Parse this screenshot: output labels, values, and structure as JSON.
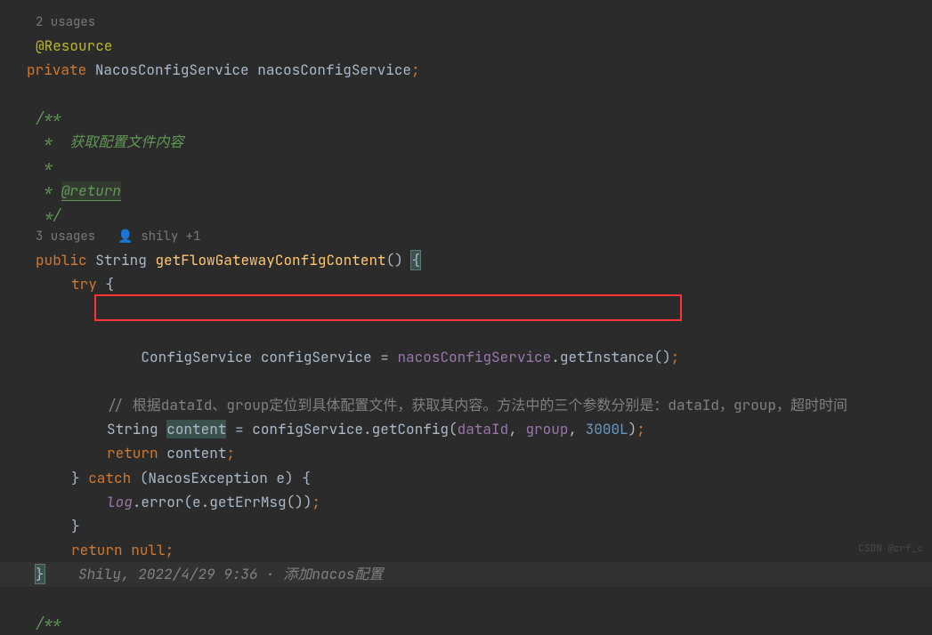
{
  "usages1": "2 usages",
  "annotation1": "@Resource",
  "field_decl": {
    "modifier": "private",
    "type": "NacosConfigService",
    "name": "nacosConfigService"
  },
  "javadoc": {
    "open": "/**",
    "desc_prefix": " *  ",
    "desc": "获取配置文件内容",
    "empty": " *",
    "return_prefix": " * ",
    "return_tag": "@return",
    "close": " */"
  },
  "usages2": "3 usages",
  "author": "shily +1",
  "method": {
    "modifier": "public",
    "return_type": "String",
    "name": "getFlowGatewayConfigContent"
  },
  "try_kw": "try",
  "line_config": {
    "type": "ConfigService",
    "var": "configService",
    "eq": " = ",
    "field": "nacosConfigService",
    "method": ".getInstance()"
  },
  "comment_cn": "// 根据dataId、group定位到具体配置文件，获取其内容。方法中的三个参数分别是：dataId，group，超时时间",
  "line_getconfig": {
    "type": "String",
    "var": "content",
    "eq": " = configService.getConfig(",
    "p1": "dataId",
    "p2": "group",
    "p3": "3000L",
    "close": ")"
  },
  "return1_kw": "return",
  "return1_var": "content",
  "catch_kw": "catch",
  "catch_type": "NacosException e",
  "log_line": {
    "log": "log",
    "rest": ".error(e.getErrMsg())"
  },
  "return2": "return null",
  "commit_author": "Shily, 2022/4/29 9:36 · 添加nacos配置",
  "javadoc2_open": "/**",
  "watermark": "CSDN @crf_c"
}
